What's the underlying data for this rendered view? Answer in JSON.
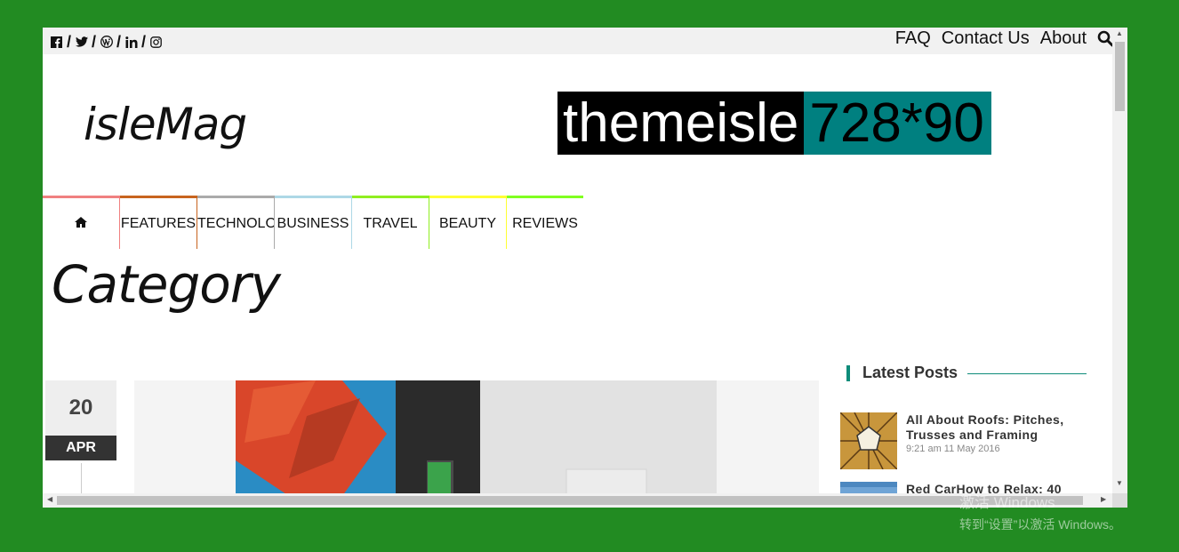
{
  "topbar": {
    "social_icons": [
      "facebook-icon",
      "twitter-icon",
      "wordpress-icon",
      "linkedin-icon",
      "instagram-icon"
    ],
    "separator": "/",
    "nav": [
      "FAQ",
      "Contact Us",
      "About"
    ],
    "search_icon": "search-icon"
  },
  "header": {
    "logo": "isleMag",
    "banner_part1": "themeisle",
    "banner_part2": "728*90"
  },
  "mainnav": {
    "items": [
      {
        "label": "",
        "icon": "home-icon",
        "color": "#f08080"
      },
      {
        "label": "FEATURES",
        "color": "#c8641e"
      },
      {
        "label": "TECHNOLOGY",
        "color": "#aaaaaa"
      },
      {
        "label": "BUSINESS",
        "color": "#add8e6"
      },
      {
        "label": "TRAVEL",
        "color": "#90ee20"
      },
      {
        "label": "BEAUTY",
        "color": "#ffff33"
      },
      {
        "label": "REVIEWS",
        "color": "#80ff20"
      }
    ]
  },
  "page": {
    "title": "Category"
  },
  "post": {
    "day": "20",
    "month": "APR"
  },
  "sidebar": {
    "latest_title": "Latest Posts",
    "posts": [
      {
        "title": "All About Roofs: Pitches, Trusses and Framing",
        "meta": "9:21 am 11 May 2016"
      },
      {
        "title": "Red CarHow to Relax: 40",
        "meta": ""
      }
    ]
  },
  "overlay": {
    "line1": "激活 Windows",
    "line2": "转到“设置”以激活 Windows。"
  }
}
